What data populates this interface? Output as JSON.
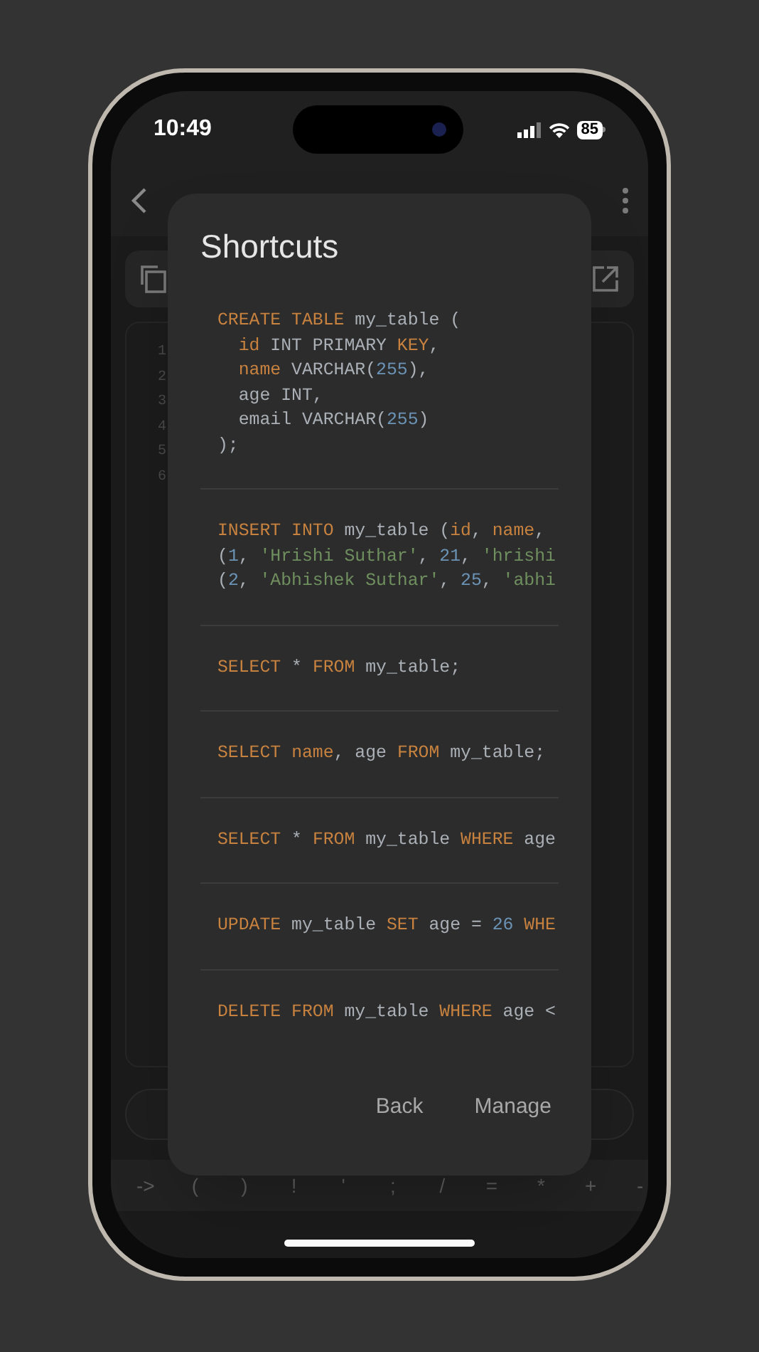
{
  "status_bar": {
    "time": "10:49",
    "battery": "85"
  },
  "editor": {
    "line_numbers": [
      "1",
      "2",
      "3",
      "4",
      "5",
      "6"
    ]
  },
  "symbol_keys": [
    "->",
    "(",
    ")",
    "!",
    "'",
    ";",
    "/",
    "=",
    "*",
    "+",
    "-"
  ],
  "dialog": {
    "title": "Shortcuts",
    "snippets": [
      {
        "lines": [
          [
            {
              "text": "CREATE TABLE",
              "kind": "keyword"
            },
            {
              "text": " my_table (",
              "kind": "plain"
            }
          ],
          [
            {
              "text": "  id",
              "kind": "keyword"
            },
            {
              "text": " INT PRIMARY ",
              "kind": "plain"
            },
            {
              "text": "KEY",
              "kind": "keyword"
            },
            {
              "text": ",",
              "kind": "plain"
            }
          ],
          [
            {
              "text": "  name",
              "kind": "keyword"
            },
            {
              "text": " VARCHAR(",
              "kind": "plain"
            },
            {
              "text": "255",
              "kind": "number"
            },
            {
              "text": "),",
              "kind": "plain"
            }
          ],
          [
            {
              "text": "  age INT,",
              "kind": "plain"
            }
          ],
          [
            {
              "text": "  email VARCHAR(",
              "kind": "plain"
            },
            {
              "text": "255",
              "kind": "number"
            },
            {
              "text": ")",
              "kind": "plain"
            }
          ],
          [
            {
              "text": ");",
              "kind": "plain"
            }
          ]
        ]
      },
      {
        "lines": [
          [
            {
              "text": "INSERT INTO",
              "kind": "keyword"
            },
            {
              "text": " my_table (",
              "kind": "plain"
            },
            {
              "text": "id",
              "kind": "keyword"
            },
            {
              "text": ", ",
              "kind": "plain"
            },
            {
              "text": "name",
              "kind": "keyword"
            },
            {
              "text": ",",
              "kind": "plain"
            }
          ],
          [
            {
              "text": "(",
              "kind": "plain"
            },
            {
              "text": "1",
              "kind": "number"
            },
            {
              "text": ", ",
              "kind": "plain"
            },
            {
              "text": "'Hrishi Suthar'",
              "kind": "string"
            },
            {
              "text": ", ",
              "kind": "plain"
            },
            {
              "text": "21",
              "kind": "number"
            },
            {
              "text": ", ",
              "kind": "plain"
            },
            {
              "text": "'hrishi",
              "kind": "string"
            }
          ],
          [
            {
              "text": "(",
              "kind": "plain"
            },
            {
              "text": "2",
              "kind": "number"
            },
            {
              "text": ", ",
              "kind": "plain"
            },
            {
              "text": "'Abhishek Suthar'",
              "kind": "string"
            },
            {
              "text": ", ",
              "kind": "plain"
            },
            {
              "text": "25",
              "kind": "number"
            },
            {
              "text": ", ",
              "kind": "plain"
            },
            {
              "text": "'abhi",
              "kind": "string"
            }
          ]
        ]
      },
      {
        "lines": [
          [
            {
              "text": "SELECT",
              "kind": "keyword"
            },
            {
              "text": " * ",
              "kind": "plain"
            },
            {
              "text": "FROM",
              "kind": "keyword"
            },
            {
              "text": " my_table;",
              "kind": "plain"
            }
          ]
        ]
      },
      {
        "lines": [
          [
            {
              "text": "SELECT ",
              "kind": "keyword"
            },
            {
              "text": "name",
              "kind": "keyword"
            },
            {
              "text": ", age ",
              "kind": "plain"
            },
            {
              "text": "FROM",
              "kind": "keyword"
            },
            {
              "text": " my_table;",
              "kind": "plain"
            }
          ]
        ]
      },
      {
        "lines": [
          [
            {
              "text": "SELECT",
              "kind": "keyword"
            },
            {
              "text": " * ",
              "kind": "plain"
            },
            {
              "text": "FROM",
              "kind": "keyword"
            },
            {
              "text": " my_table ",
              "kind": "plain"
            },
            {
              "text": "WHERE",
              "kind": "keyword"
            },
            {
              "text": " age",
              "kind": "plain"
            }
          ]
        ]
      },
      {
        "lines": [
          [
            {
              "text": "UPDATE",
              "kind": "keyword"
            },
            {
              "text": " my_table ",
              "kind": "plain"
            },
            {
              "text": "SET",
              "kind": "keyword"
            },
            {
              "text": " age = ",
              "kind": "plain"
            },
            {
              "text": "26 ",
              "kind": "number"
            },
            {
              "text": "WHE",
              "kind": "keyword"
            }
          ]
        ]
      },
      {
        "lines": [
          [
            {
              "text": "DELETE FROM",
              "kind": "keyword"
            },
            {
              "text": " my_table ",
              "kind": "plain"
            },
            {
              "text": "WHERE",
              "kind": "keyword"
            },
            {
              "text": " age <",
              "kind": "plain"
            }
          ]
        ]
      }
    ],
    "buttons": [
      "Back",
      "Manage"
    ]
  }
}
